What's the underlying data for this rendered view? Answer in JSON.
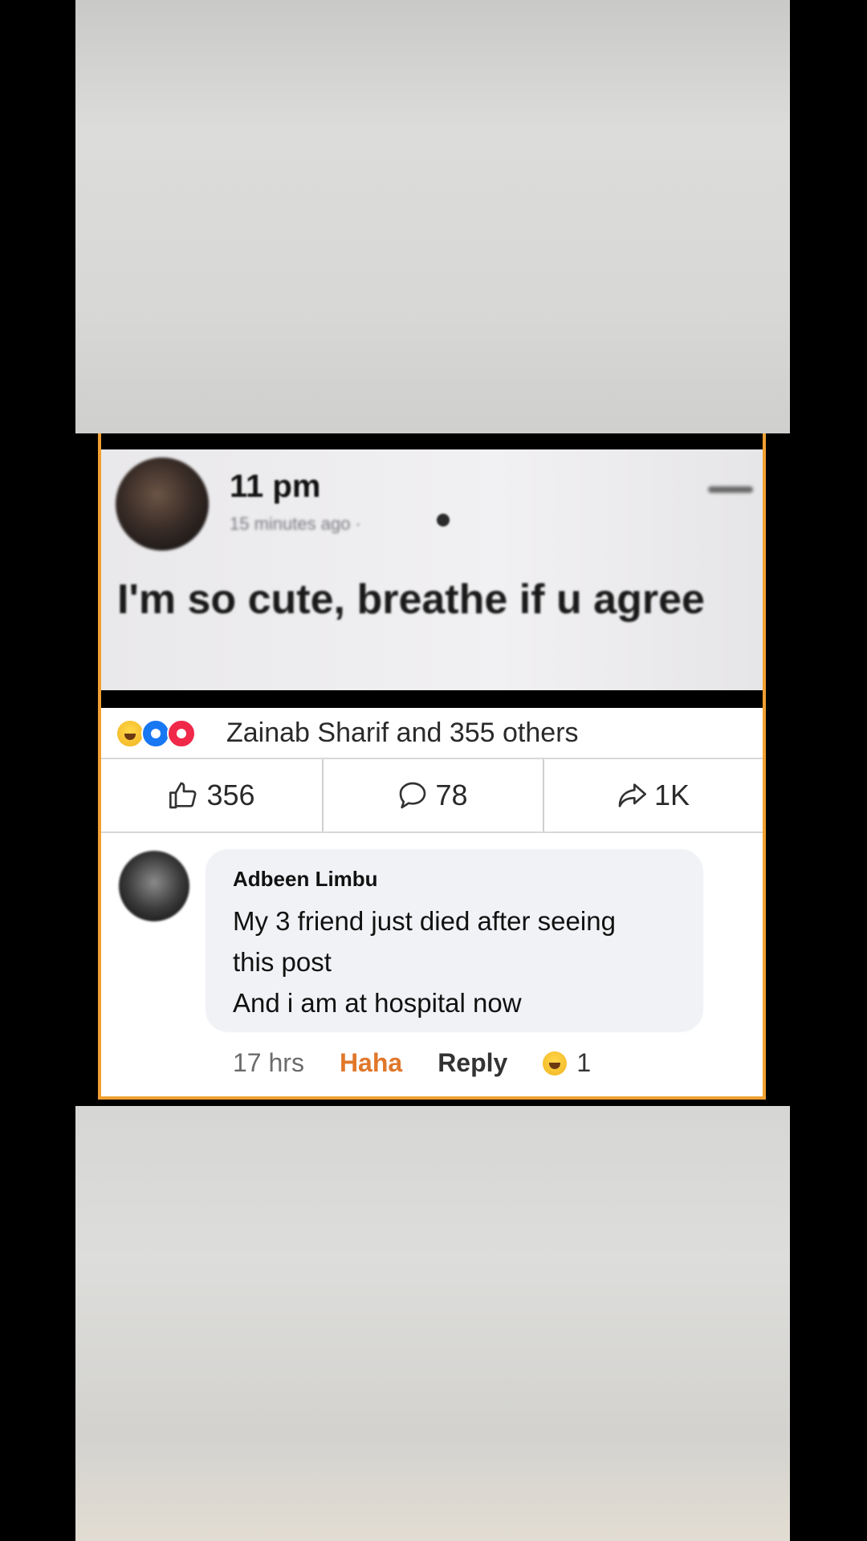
{
  "post": {
    "author": "11 pm",
    "time": "15 minutes ago ·",
    "text": "I'm so cute, breathe if u agree"
  },
  "reactions": {
    "summary": "Zainab Sharif and 355 others",
    "types": [
      "haha-icon",
      "like-icon",
      "love-icon"
    ]
  },
  "stats": {
    "likes": "356",
    "comments": "78",
    "shares": "1K"
  },
  "comment": {
    "author": "Adbeen Limbu",
    "lines": [
      "My 3 friend just died after seeing",
      "this post",
      "And i am at hospital now"
    ],
    "time": "17 hrs",
    "haha_label": "Haha",
    "reply_label": "Reply",
    "reaction_count": "1"
  },
  "colors": {
    "frame_border": "#f0a030",
    "like_blue": "#1877f2",
    "love_red": "#f02849",
    "haha_yellow": "#f1b320"
  }
}
